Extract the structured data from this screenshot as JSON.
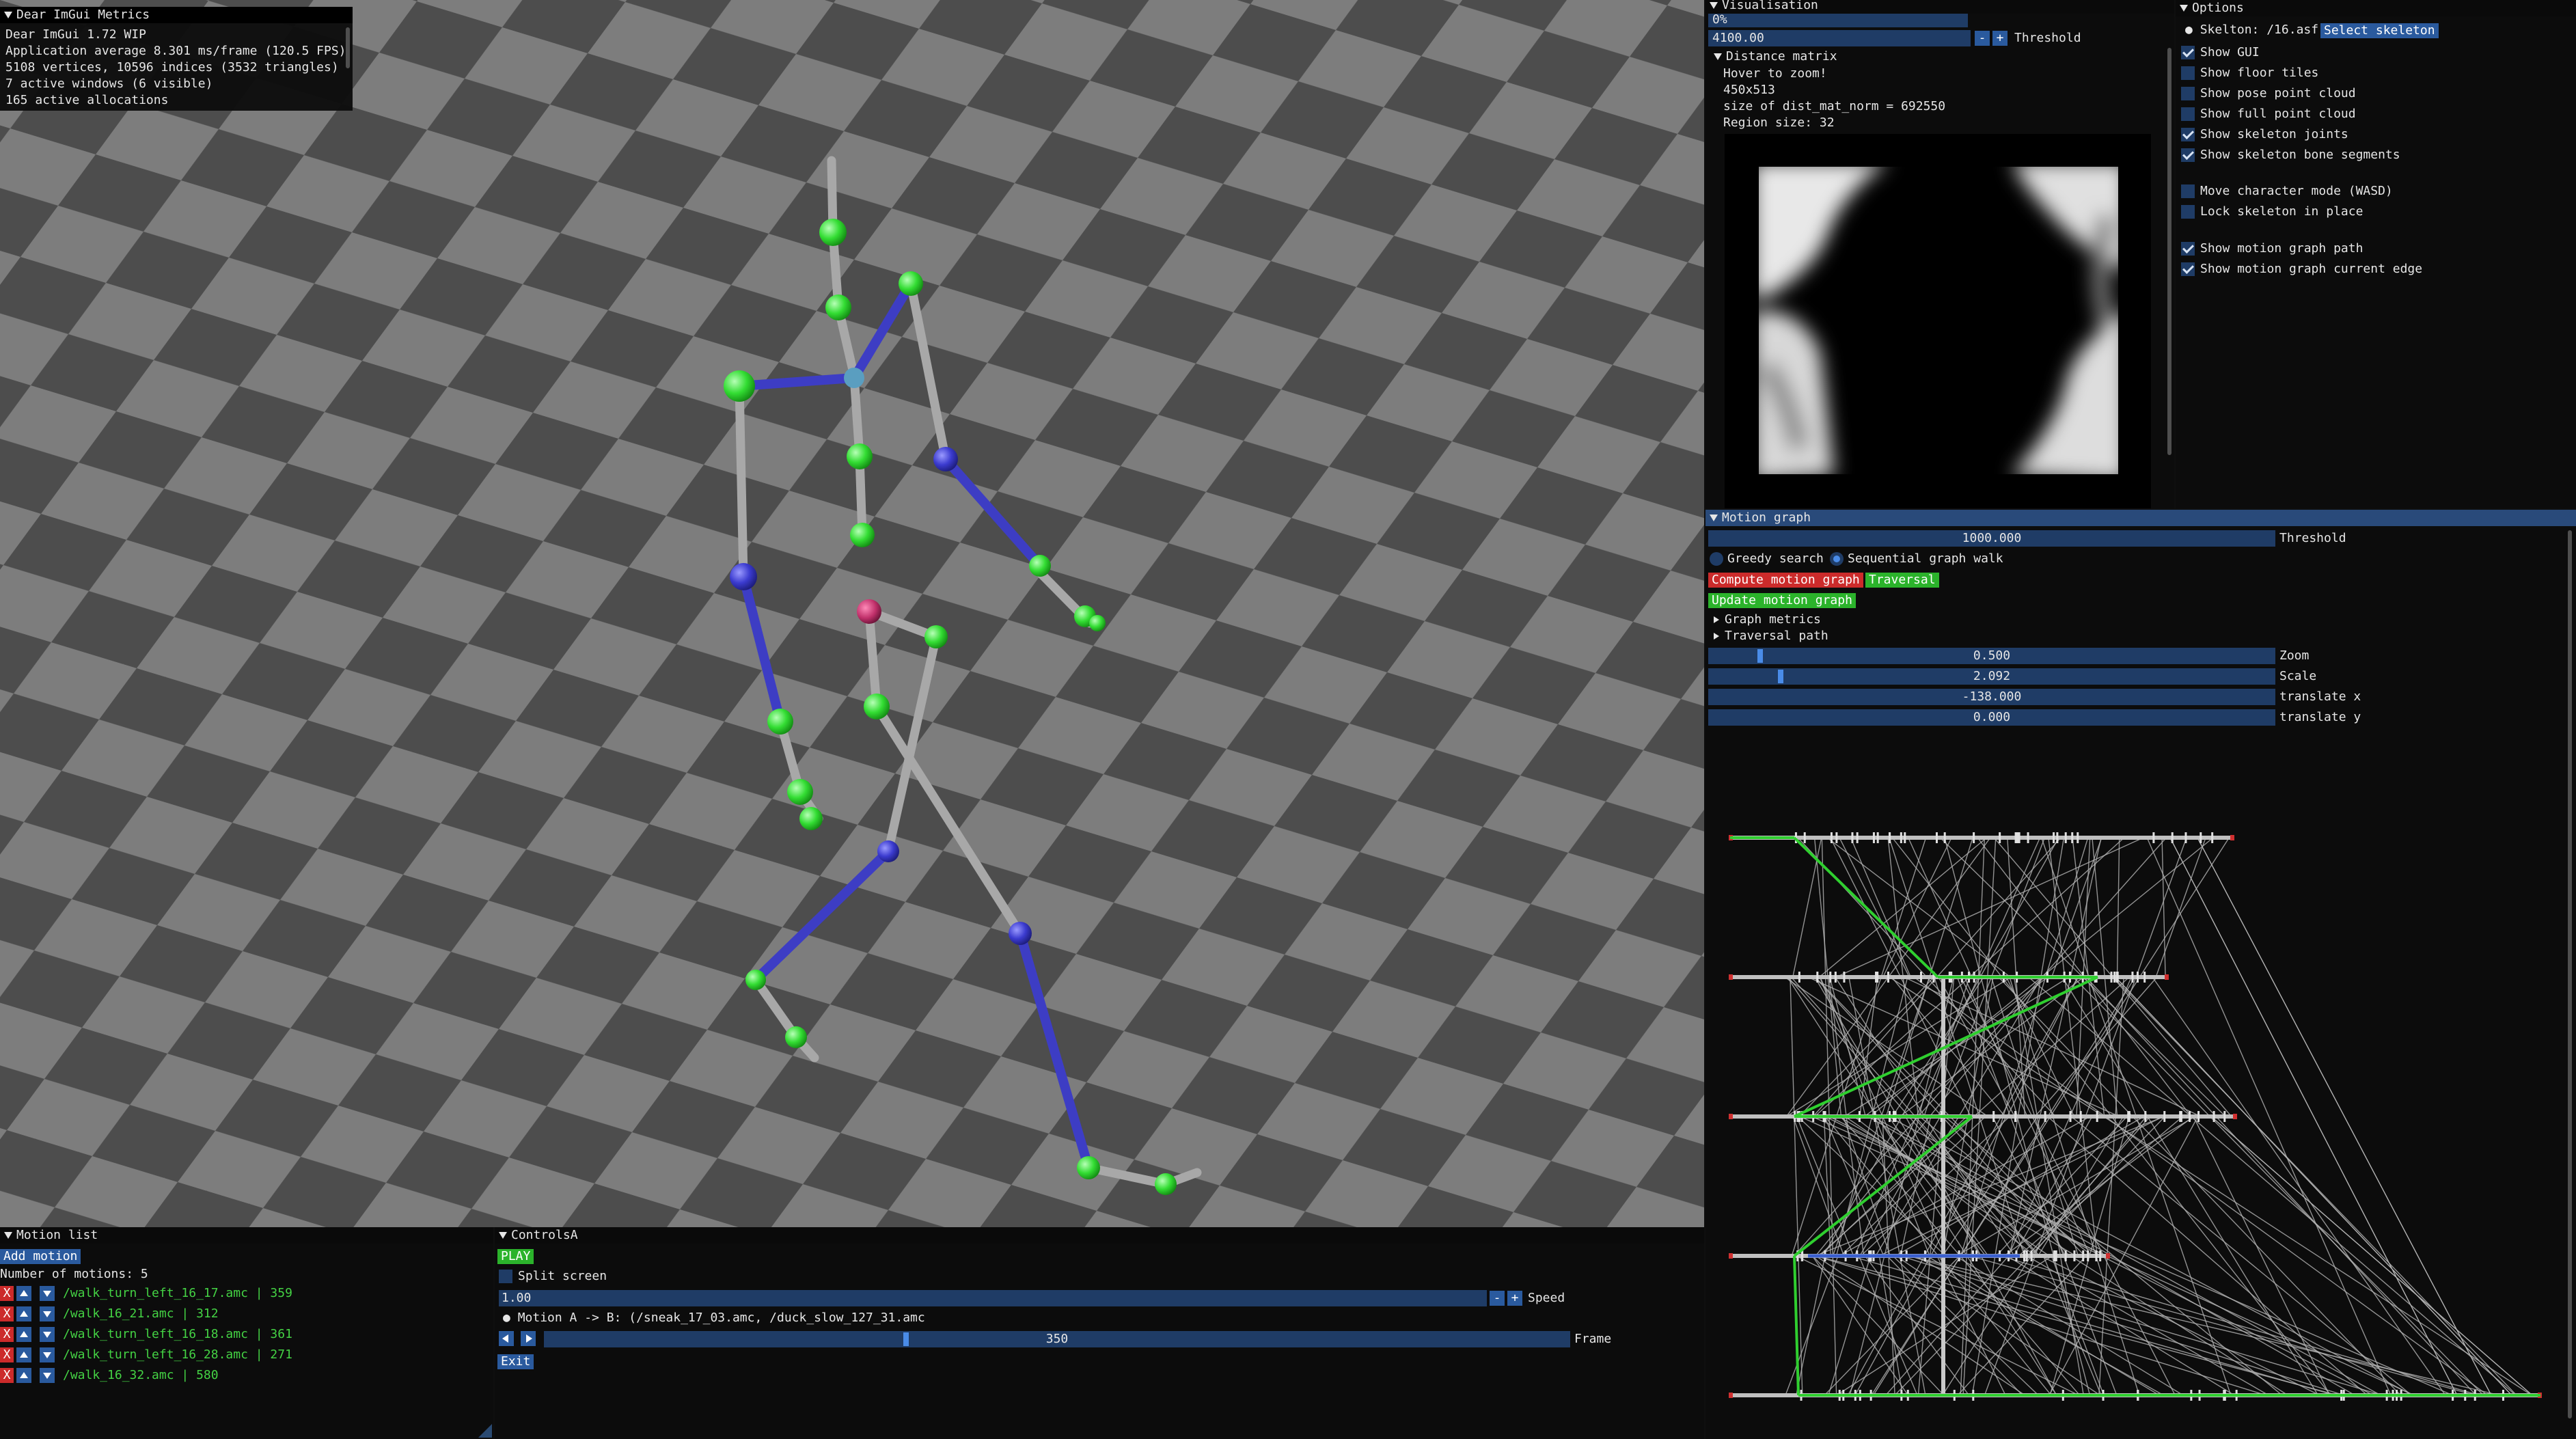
{
  "metrics": {
    "title": "Dear ImGui Metrics",
    "lines": [
      "Dear ImGui 1.72 WIP",
      "Application average 8.301 ms/frame (120.5 FPS)",
      "5108 vertices, 10596 indices (3532 triangles)",
      "7 active windows (6 visible)",
      "165 active allocations"
    ]
  },
  "visualisation": {
    "title": "Visualisation",
    "progress_label": "0%",
    "progress_fraction": 0.0,
    "threshold_value": "4100.00",
    "threshold_label": "Threshold",
    "minus": "-",
    "plus": "+",
    "distance_matrix": {
      "header": "Distance matrix",
      "hover_hint": "Hover to zoom!",
      "dims": "450x513",
      "size_text": "size of dist_mat_norm = 692550",
      "region_text": "Region size: 32"
    }
  },
  "options": {
    "title": "Options",
    "skeleton_label": "Skelton: /16.asf",
    "select_skeleton": "Select skeleton",
    "checkboxes": [
      {
        "label": "Show GUI",
        "checked": true
      },
      {
        "label": "Show floor tiles",
        "checked": false
      },
      {
        "label": "Show pose point cloud",
        "checked": false
      },
      {
        "label": "Show full point cloud",
        "checked": false
      },
      {
        "label": "Show skeleton joints",
        "checked": true
      },
      {
        "label": "Show skeleton bone segments",
        "checked": true
      },
      {
        "label": "Move character mode (WASD)",
        "checked": false
      },
      {
        "label": "Lock skeleton in place",
        "checked": false
      },
      {
        "label": "Show motion graph path",
        "checked": true
      },
      {
        "label": "Show motion graph current edge",
        "checked": true
      }
    ]
  },
  "motion_graph": {
    "title": "Motion graph",
    "threshold_value": "1000.000",
    "threshold_label": "Threshold",
    "greedy_label": "Greedy search",
    "sequential_label": "Sequential graph walk",
    "selected_mode": "Sequential graph walk",
    "compute_btn": "Compute motion graph",
    "traversal_btn": "Traversal",
    "update_btn": "Update motion graph",
    "graph_metrics": "Graph metrics",
    "traversal_path": "Traversal path",
    "sliders": [
      {
        "label": "Zoom",
        "value": "0.500"
      },
      {
        "label": "Scale",
        "value": "2.092"
      },
      {
        "label": "translate x",
        "value": "-138.000"
      },
      {
        "label": "translate y",
        "value": "0.000"
      }
    ]
  },
  "motion_list": {
    "title": "Motion list",
    "add_btn": "Add motion",
    "count_text": "Number of motions: 5",
    "remove": "X",
    "items": [
      "/walk_turn_left_16_17.amc | 359",
      "/walk_16_21.amc | 312",
      "/walk_turn_left_16_18.amc | 361",
      "/walk_turn_left_16_28.amc | 271",
      "/walk_16_32.amc | 580"
    ]
  },
  "controls": {
    "title": "ControlsA",
    "play": "PLAY",
    "split_screen": "Split screen",
    "split_checked": false,
    "speed_value": "1.00",
    "speed_label": "Speed",
    "minus": "-",
    "plus": "+",
    "motion_ab": "Motion A -> B: (/sneak_17_03.amc, /duck_slow_127_31.amc",
    "frame_value": "350",
    "frame_label": "Frame",
    "exit": "Exit"
  },
  "colors": {
    "accent": "#2a5a9e",
    "frame_bg": "#1f3c66",
    "green": "#2bb32b",
    "red": "#cc2b2b",
    "joint_green": "#38e838",
    "joint_blue": "#4040d0",
    "root_magenta": "#c0306a"
  }
}
